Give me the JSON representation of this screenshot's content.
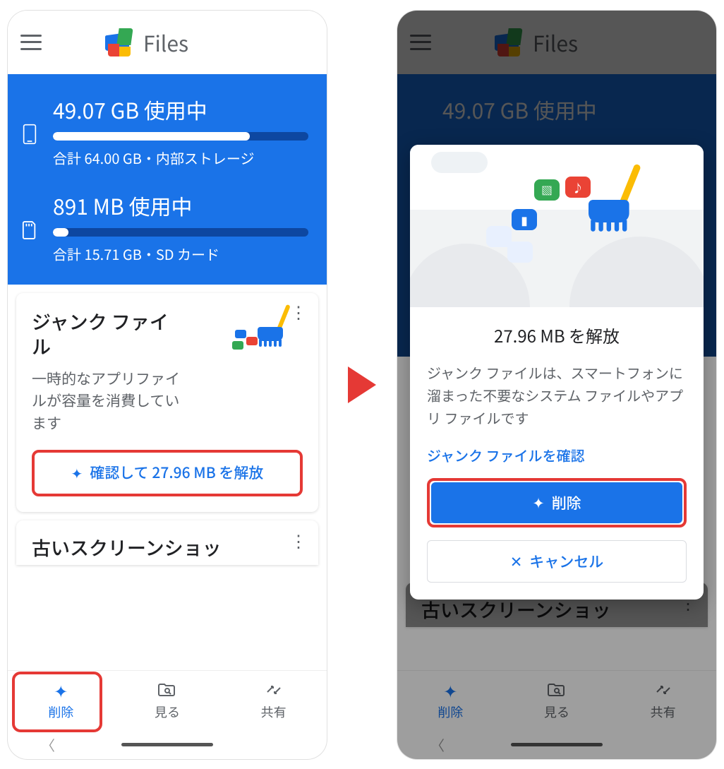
{
  "app": {
    "title": "Files"
  },
  "storage": {
    "internal": {
      "used_label": "49.07 GB 使用中",
      "detail": "合計 64.00 GB・内部ストレージ",
      "fill_pct": 77
    },
    "sd": {
      "used_label": "891 MB 使用中",
      "detail": "合計 15.71 GB・SD カード",
      "fill_pct": 6
    }
  },
  "junk_card": {
    "title": "ジャンク ファイル",
    "desc": "一時的なアプリファイルが容量を消費しています",
    "free_btn": "確認して 27.96 MB を解放"
  },
  "old_screenshots_card": {
    "title": "古いスクリーンショッ"
  },
  "nav": {
    "clean": "削除",
    "browse": "見る",
    "share": "共有"
  },
  "dialog": {
    "title": "27.96 MB を解放",
    "desc": "ジャンク ファイルは、スマートフォンに溜まった不要なシステム ファイルやアプリ ファイルです",
    "link": "ジャンク ファイルを確認",
    "delete_btn": "削除",
    "cancel_btn": "キャンセル"
  }
}
